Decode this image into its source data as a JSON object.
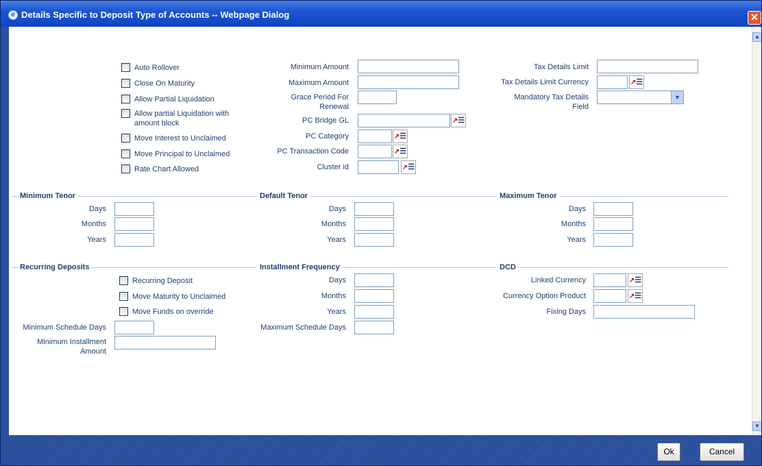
{
  "window": {
    "title": "Details Specific to Deposit Type of Accounts -- Webpage Dialog",
    "close_label": "✕"
  },
  "checkboxes": {
    "auto_rollover": "Auto Rollover",
    "close_on_maturity": "Close On Maturity",
    "allow_partial_liquidation": "Allow Partial Liquidation",
    "allow_partial_liq_block": "Allow partial Liquidation with amount block",
    "move_interest_unclaimed": "Move Interest to Unclaimed",
    "move_principal_unclaimed": "Move Principal to Unclaimed",
    "rate_chart_allowed": "Rate Chart Allowed"
  },
  "middle_fields": {
    "minimum_amount": "Minimum Amount",
    "maximum_amount": "Maximum Amount",
    "grace_period": "Grace Period For Renewal",
    "pc_bridge_gl": "PC Bridge GL",
    "pc_category": "PC Category",
    "pc_transaction_code": "PC Transaction Code",
    "cluster_id": "Cluster id"
  },
  "right_fields": {
    "tax_details_limit": "Tax Details Limit",
    "tax_details_limit_currency": "Tax Details Limit Currency",
    "mandatory_tax_details_field": "Mandatory Tax Details Field",
    "mandatory_tax_value": ""
  },
  "sections": {
    "minimum_tenor": "Minimum Tenor",
    "default_tenor": "Default Tenor",
    "maximum_tenor": "Maximum Tenor",
    "recurring_deposits": "Recurring Deposits",
    "installment_frequency": "Installment Frequency",
    "dcd": "DCD"
  },
  "tenor_labels": {
    "days": "Days",
    "months": "Months",
    "years": "Years"
  },
  "recurring": {
    "recurring_deposit": "Recurring Deposit",
    "move_maturity_unclaimed": "Move Maturity to Unclaimed",
    "move_funds_override": "Move Funds on override",
    "minimum_schedule_days": "Minimum Schedule Days",
    "minimum_installment_amount": "Minimum Installment Amount"
  },
  "installment": {
    "maximum_schedule_days": "Maximum Schedule Days"
  },
  "dcd": {
    "linked_currency": "Linked Currency",
    "currency_option_product": "Currency Option Product",
    "fixing_days": "Fixing Days"
  },
  "buttons": {
    "ok": "Ok",
    "cancel": "Cancel"
  },
  "lov_glyph": "↗",
  "lov_lines": "☰"
}
